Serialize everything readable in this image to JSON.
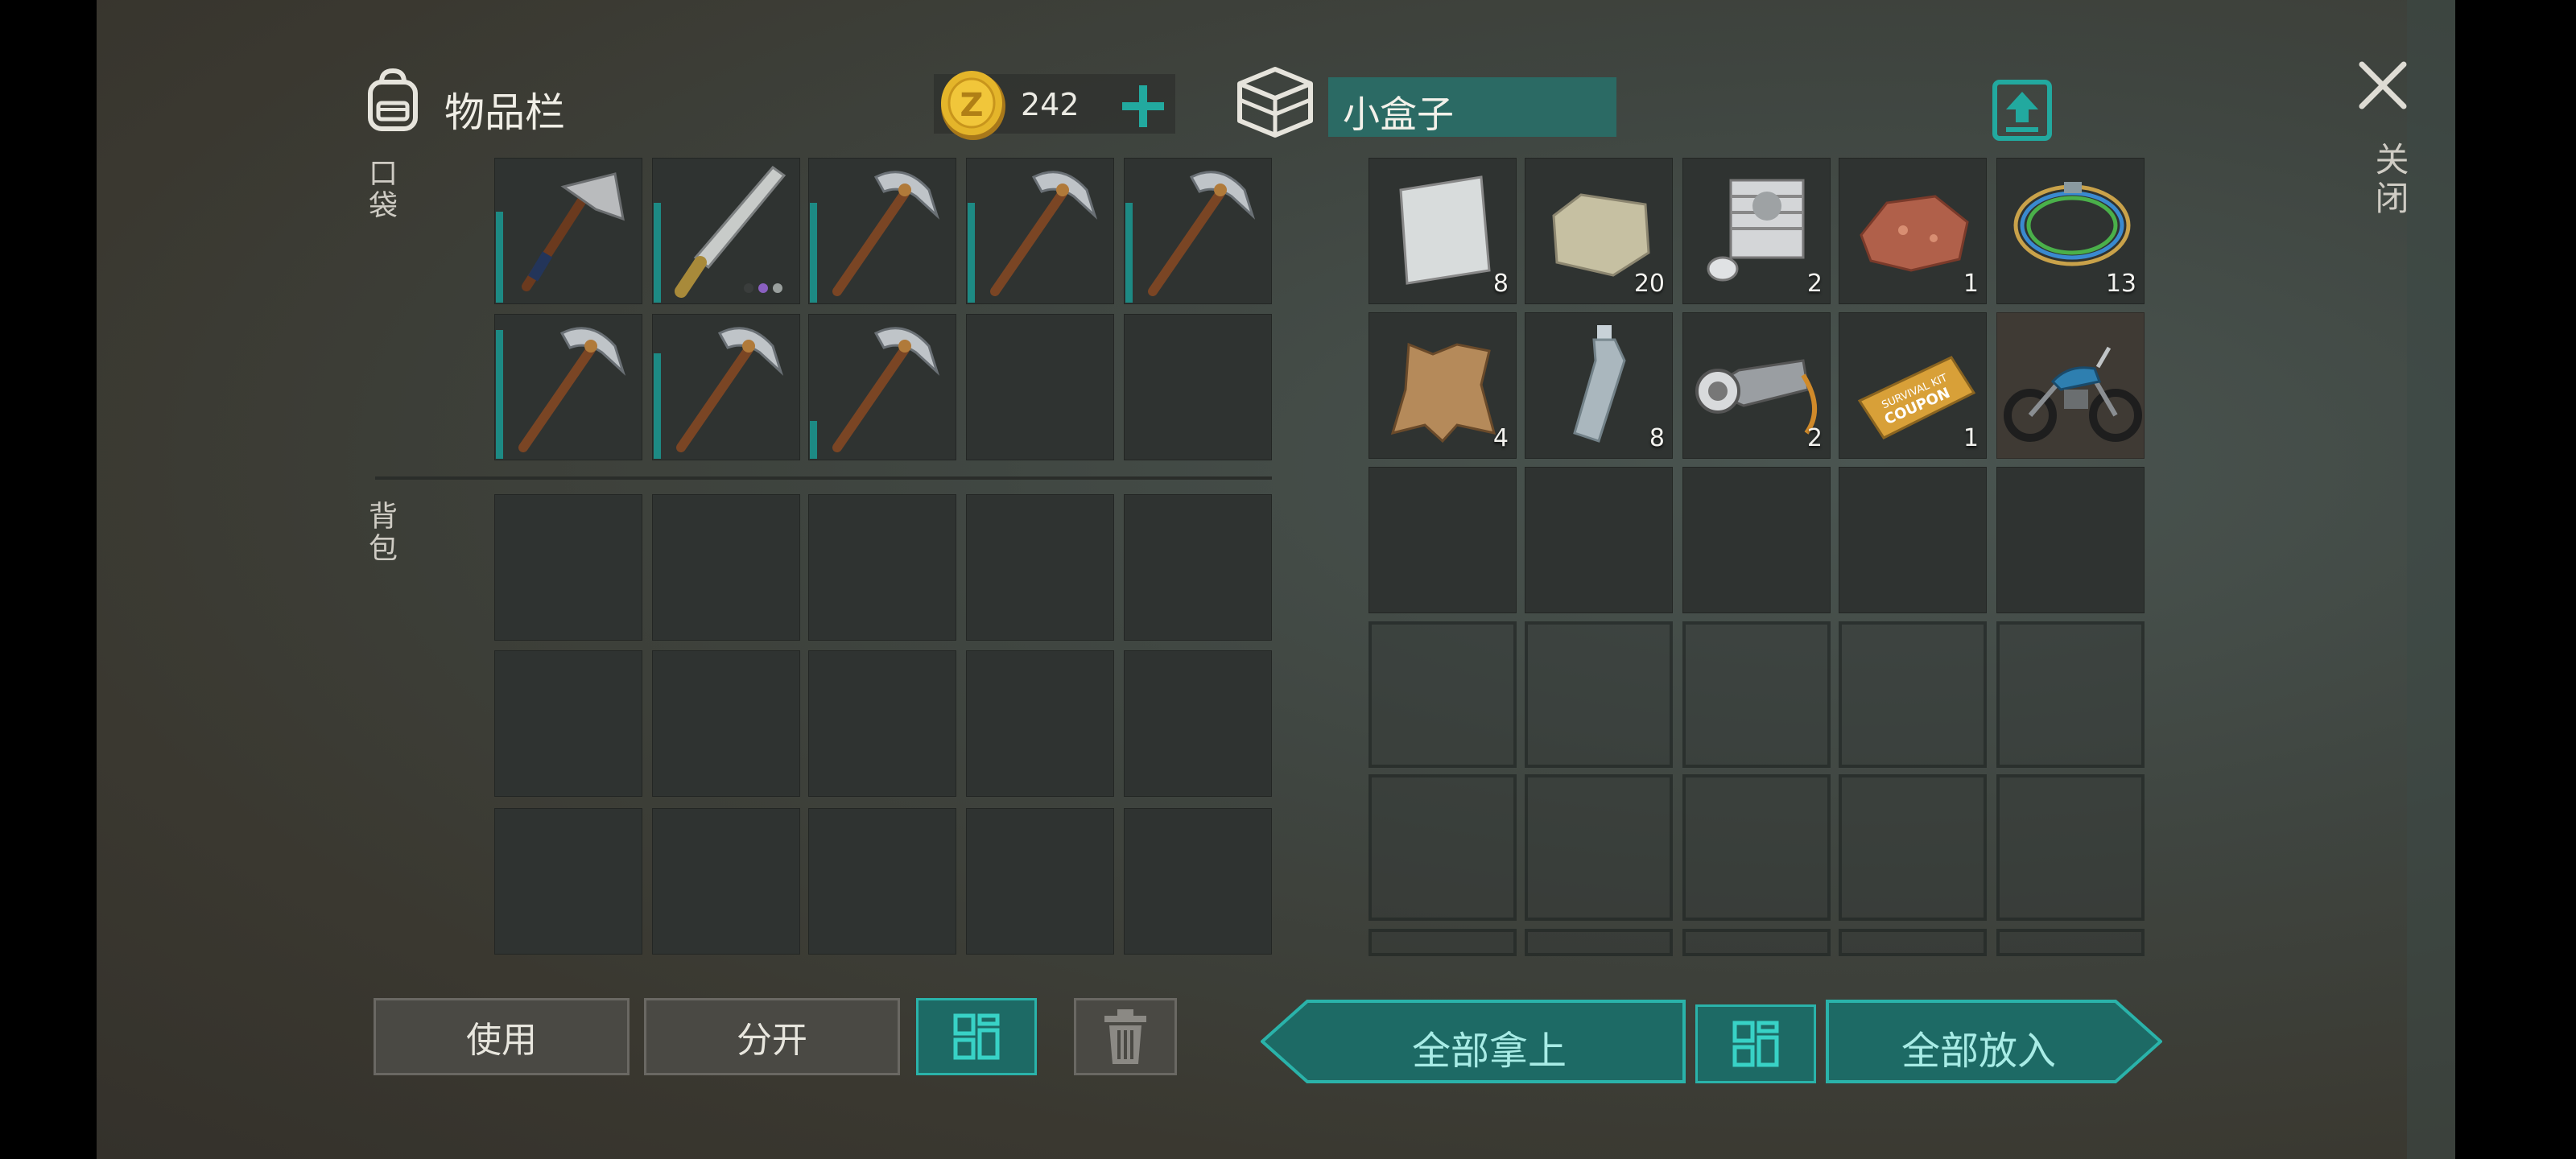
{
  "inventory": {
    "title": "物品栏",
    "currency_amount": "242",
    "pocket_label": "口袋",
    "backpack_label": "背包",
    "pocket_items": [
      {
        "name": "hatchet",
        "count": ""
      },
      {
        "name": "machete",
        "count": ""
      },
      {
        "name": "pickaxe",
        "count": ""
      },
      {
        "name": "pickaxe",
        "count": ""
      },
      {
        "name": "pickaxe",
        "count": ""
      },
      {
        "name": "pickaxe",
        "count": ""
      },
      {
        "name": "pickaxe",
        "count": ""
      },
      {
        "name": "pickaxe",
        "count": ""
      }
    ]
  },
  "container": {
    "title": "小盒子",
    "items": [
      {
        "name": "steel-sheet",
        "count": "8"
      },
      {
        "name": "stone",
        "count": "20"
      },
      {
        "name": "engine-cylinder",
        "count": "2"
      },
      {
        "name": "iron-ore",
        "count": "1"
      },
      {
        "name": "wires",
        "count": "13"
      },
      {
        "name": "animal-hide",
        "count": "4"
      },
      {
        "name": "plastic-bottle",
        "count": "8"
      },
      {
        "name": "flashlight",
        "count": "2"
      },
      {
        "name": "survival-kit-coupon",
        "count": "1"
      },
      {
        "name": "motorcycle",
        "count": ""
      }
    ],
    "coupon_text_top": "SURVIVAL KIT",
    "coupon_text_bottom": "COUPON"
  },
  "buttons": {
    "use": "使用",
    "split": "分开",
    "take_all": "全部拿上",
    "put_all": "全部放入",
    "close": "关闭"
  },
  "colors": {
    "accent_teal": "#1d8a84",
    "teal_border": "#2ab3aa",
    "slot_bg": "#2f3331",
    "coin_gold": "#e4b52a"
  }
}
